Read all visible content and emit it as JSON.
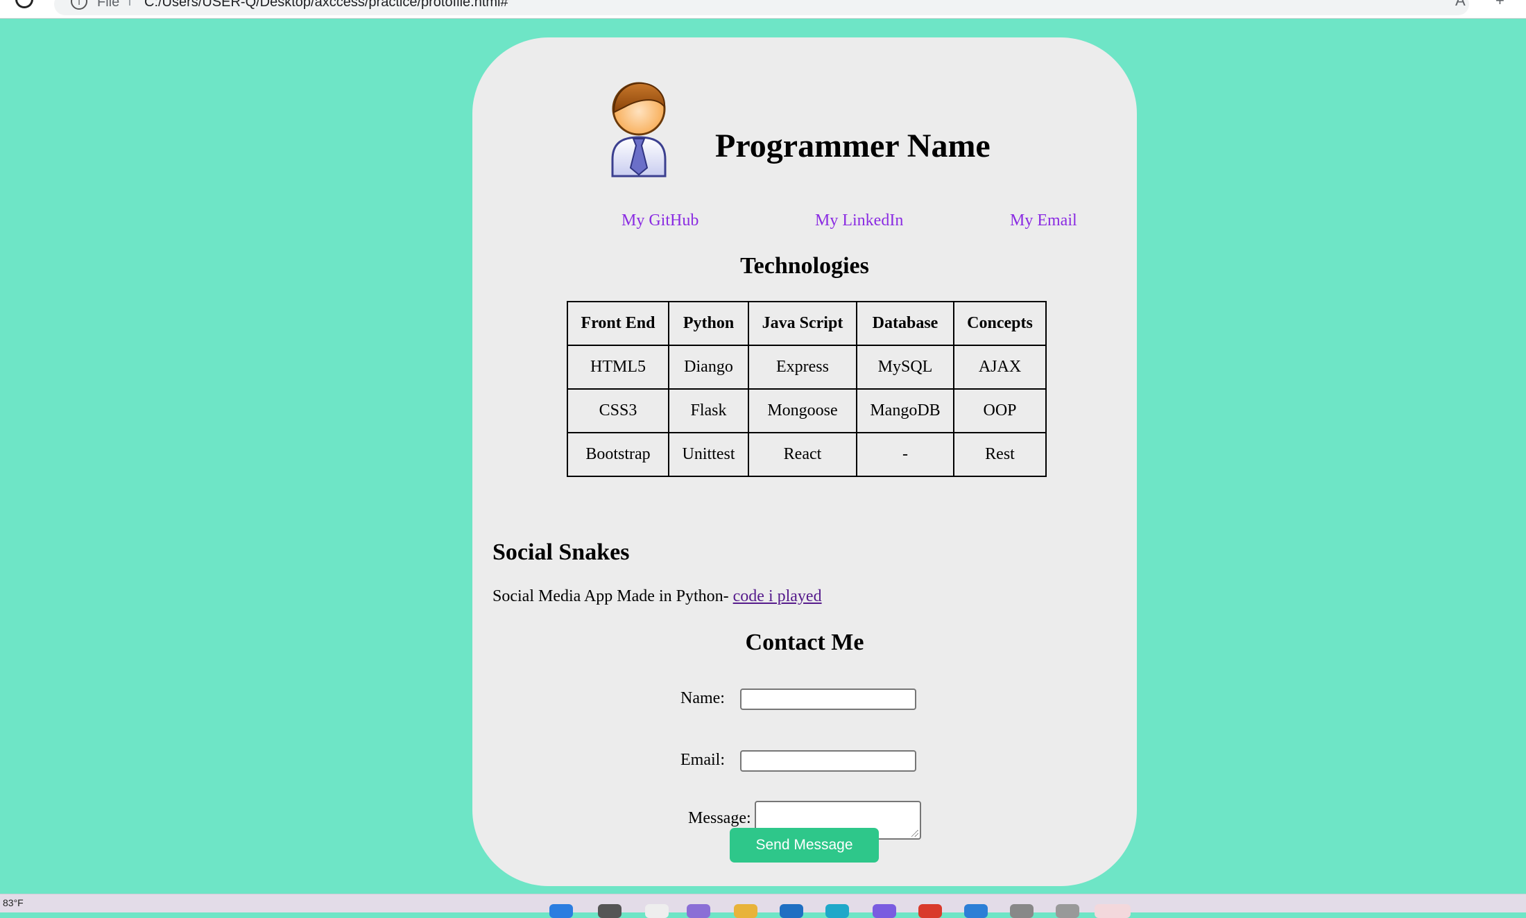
{
  "browser": {
    "file_label": "File",
    "url": "C:/Users/USER-Q/Desktop/axccess/practice/protofile.html#"
  },
  "header": {
    "title": "Programmer Name"
  },
  "nav": {
    "links": [
      "My GitHub",
      "My LinkedIn",
      "My Email"
    ]
  },
  "technologies": {
    "heading": "Technologies",
    "columns": [
      "Front End",
      "Python",
      "Java Script",
      "Database",
      "Concepts"
    ],
    "rows": [
      [
        "HTML5",
        "Diango",
        "Express",
        "MySQL",
        "AJAX"
      ],
      [
        "CSS3",
        "Flask",
        "Mongoose",
        "MangoDB",
        "OOP"
      ],
      [
        "Bootstrap",
        "Unittest",
        "React",
        "-",
        "Rest"
      ]
    ]
  },
  "project": {
    "title": "Social Snakes",
    "description": "Social Media App Made in Python- ",
    "link_text": "code i played"
  },
  "contact": {
    "heading": "Contact Me",
    "name_label": "Name:",
    "email_label": "Email:",
    "message_label": "Message:",
    "name_value": "",
    "email_value": "",
    "message_value": "",
    "submit_label": "Send Message"
  },
  "taskbar": {
    "weather": "83°F"
  },
  "colors": {
    "page_background": "#6ee5c6",
    "card_background": "#ececec",
    "link": "#8a2be2",
    "visited_link": "#551a8b",
    "button": "#2ec78a"
  }
}
